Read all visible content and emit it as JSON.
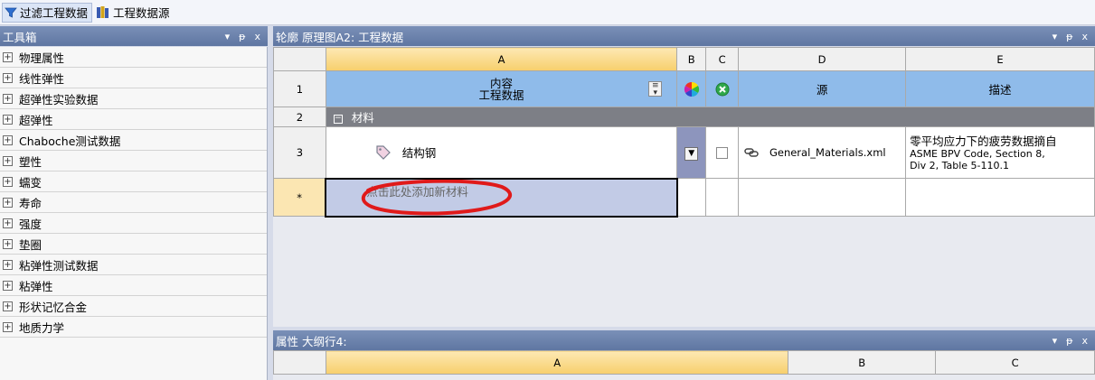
{
  "toolbar": {
    "filter_label": "过滤工程数据",
    "sources_label": "工程数据源"
  },
  "toolbox": {
    "title": "工具箱",
    "controls": [
      "▾",
      "ᵽ",
      "x"
    ],
    "items": [
      "物理属性",
      "线性弹性",
      "超弹性实验数据",
      "超弹性",
      "Chaboche测试数据",
      "塑性",
      "蠕变",
      "寿命",
      "强度",
      "垫圈",
      "粘弹性测试数据",
      "粘弹性",
      "形状记忆合金",
      "地质力学"
    ]
  },
  "outline": {
    "title": "轮廓 原理图A2: 工程数据",
    "controls": [
      "▾",
      "ᵽ",
      "x"
    ],
    "columns": [
      "A",
      "B",
      "C",
      "D",
      "E"
    ],
    "row1": {
      "num": "1",
      "a_line1": "内容",
      "a_line2": "工程数据",
      "d": "源",
      "e": "描述"
    },
    "row2": {
      "num": "2",
      "label": "材料"
    },
    "row3": {
      "num": "3",
      "name": "结构钢",
      "source": "General_Materials.xml",
      "desc_line1": "零平均应力下的疲劳数据摘自",
      "desc_line2": "ASME BPV Code, Section 8,",
      "desc_line3": "Div 2, Table 5-110.1"
    },
    "row_add": {
      "num": "*",
      "placeholder": "点击此处添加新材料"
    }
  },
  "properties": {
    "title": "属性 大纲行4:",
    "controls": [
      "▾",
      "ᵽ",
      "x"
    ],
    "columns": [
      "A",
      "B",
      "C"
    ]
  },
  "colors": {
    "header_blue": "#8fbbea",
    "category_gray": "#7d7f86",
    "add_row": "#c2cbe6",
    "highlight_circle": "#e01a1a"
  }
}
